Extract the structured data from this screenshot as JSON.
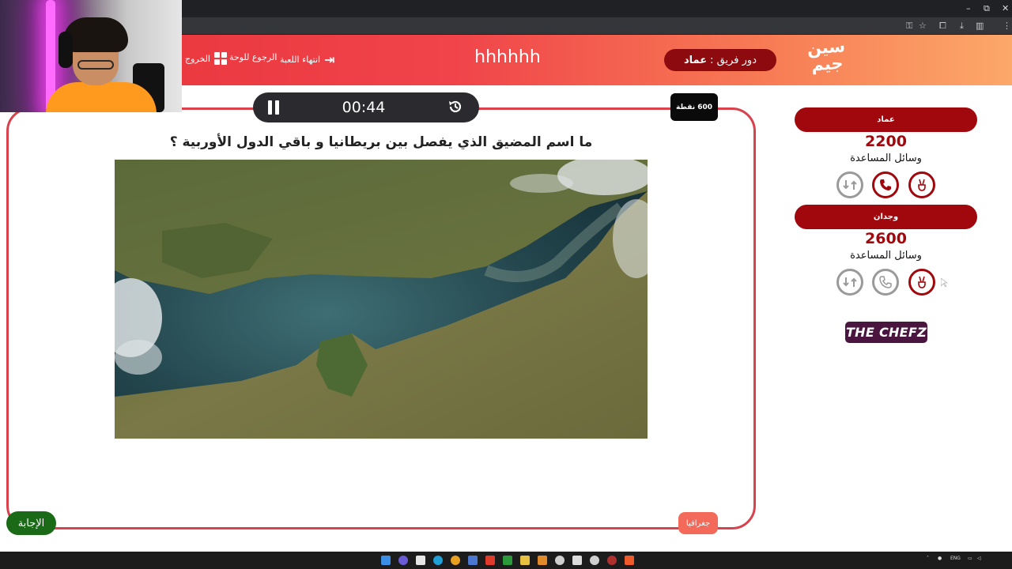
{
  "header": {
    "exit_label": "الخروج",
    "back_to_board_label": "الرجوع للوحة",
    "end_game_label": "انتهاء اللعبة",
    "game_title": "hhhhhh",
    "turn_prefix": "دور فريق :",
    "turn_team": "عماد",
    "logo_line1": "سين",
    "logo_line2": "جيم"
  },
  "question": {
    "timer": "00:44",
    "points": "600 نقطة",
    "text": "ما اسم المضيق الذي يفصل بين بريطانيا و باقي الدول الأوربية ؟",
    "category": "جغرافيا",
    "answer_button": "الإجابة"
  },
  "teams": [
    {
      "name": "عماد",
      "score": "2200",
      "aids_label": "وسائل المساعدة",
      "aids": [
        {
          "icon": "swap-icon",
          "active": false
        },
        {
          "icon": "phone-icon",
          "active": true
        },
        {
          "icon": "peace-hand-icon",
          "active": true
        }
      ]
    },
    {
      "name": "وجدان",
      "score": "2600",
      "aids_label": "وسائل المساعدة",
      "aids": [
        {
          "icon": "swap-icon",
          "active": false
        },
        {
          "icon": "phone-icon",
          "active": false
        },
        {
          "icon": "peace-hand-icon",
          "active": true
        }
      ]
    }
  ],
  "sponsor": "THE CHEFZ",
  "taskbar": {
    "lang": "ENG"
  },
  "colors": {
    "header_start": "#e8323a",
    "header_end": "#fca86a",
    "team_red": "#a0080e",
    "answer_green": "#1a6a17",
    "card_border": "#d8424c"
  }
}
